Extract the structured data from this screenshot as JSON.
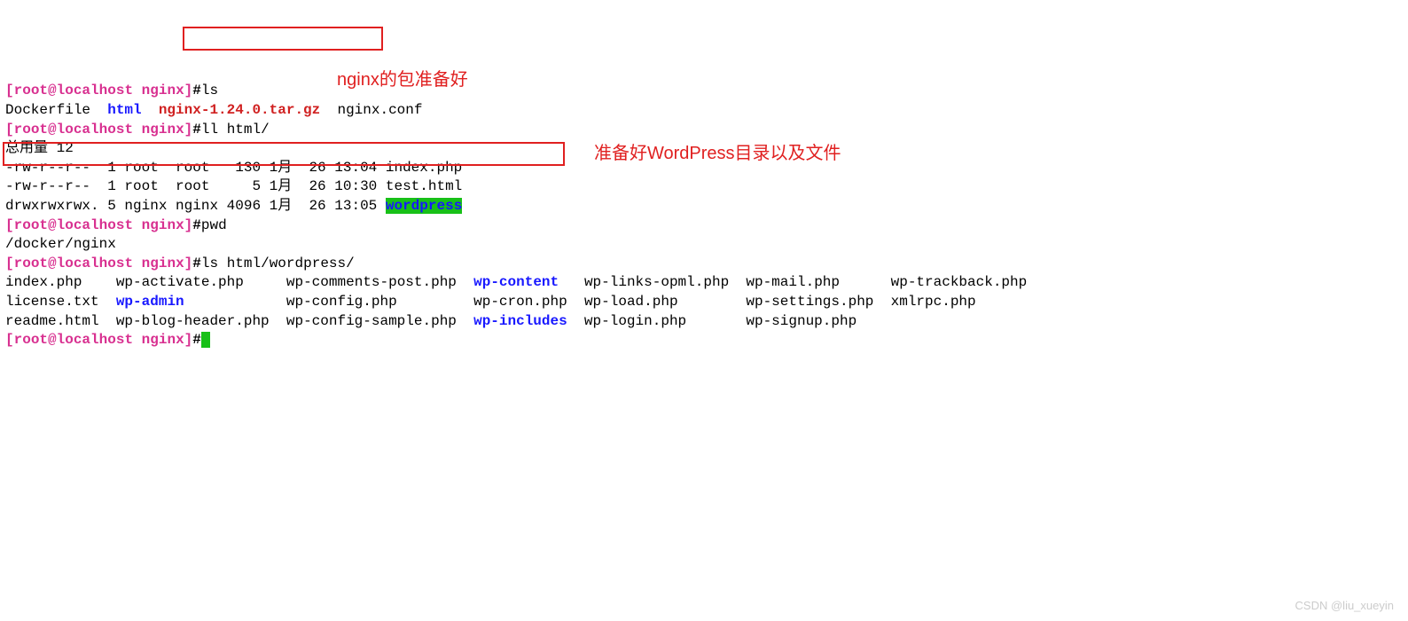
{
  "prompt": {
    "root": "root",
    "at": "@",
    "host": "localhost",
    "path": "nginx",
    "hash": "#",
    "lbracket": "[",
    "rbracket": "]"
  },
  "cmd1": {
    "text": "ls"
  },
  "ls_output": {
    "f1": "Dockerfile",
    "f2": "html",
    "f3": "nginx-1.24.0.tar.gz",
    "f4": "nginx.conf"
  },
  "cmd2": {
    "text": "ll html/"
  },
  "ll_output": {
    "total": "总用量 12",
    "r1": "-rw-r--r--  1 root  root   130 1月  26 13:04 index.php",
    "r2": "-rw-r--r--  1 root  root     5 1月  26 10:30 test.html",
    "r3_pre": "drwxrwxrwx. 5 nginx nginx 4096 1月  26 13:05 ",
    "r3_dir": "wordpress"
  },
  "cmd3": {
    "text": "pwd"
  },
  "pwd_output": "/docker/nginx",
  "cmd4": {
    "text": "ls html/wordpress/"
  },
  "wp_ls": {
    "c1r1": "index.php",
    "c2r1": "wp-activate.php",
    "c3r1": "wp-comments-post.php",
    "c4r1": "wp-content",
    "c5r1": "wp-links-opml.php",
    "c6r1": "wp-mail.php",
    "c7r1": "wp-trackback.php",
    "c1r2": "license.txt",
    "c2r2": "wp-admin",
    "c3r2": "wp-config.php",
    "c4r2": "wp-cron.php",
    "c5r2": "wp-load.php",
    "c6r2": "wp-settings.php",
    "c7r2": "xmlrpc.php",
    "c1r3": "readme.html",
    "c2r3": "wp-blog-header.php",
    "c3r3": "wp-config-sample.php",
    "c4r3": "wp-includes",
    "c5r3": "wp-login.php",
    "c6r3": "wp-signup.php"
  },
  "annotations": {
    "a1": "nginx的包准备好",
    "a2": "准备好WordPress目录以及文件"
  },
  "watermark": "CSDN @liu_xueyin"
}
